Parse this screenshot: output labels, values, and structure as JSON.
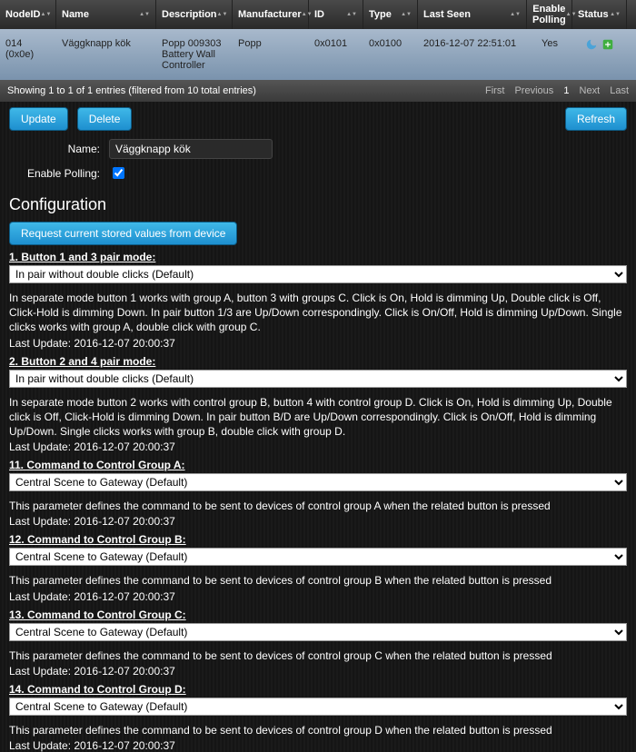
{
  "table": {
    "headers": {
      "node": "NodeID",
      "name": "Name",
      "desc": "Description",
      "manu": "Manufacturer",
      "id": "ID",
      "type": "Type",
      "last": "Last Seen",
      "poll": "Enable Polling",
      "status": "Status"
    },
    "row": {
      "node": "014 (0x0e)",
      "name": "Väggknapp kök",
      "desc": "Popp 009303 Battery Wall Controller",
      "manu": "Popp",
      "id": "0x0101",
      "type": "0x0100",
      "last": "2016-12-07 22:51:01",
      "poll": "Yes"
    },
    "footer": "Showing 1 to 1 of 1 entries (filtered from 10 total entries)",
    "pager": {
      "first": "First",
      "prev": "Previous",
      "page": "1",
      "next": "Next",
      "last": "Last"
    }
  },
  "buttons": {
    "update": "Update",
    "delete": "Delete",
    "refresh": "Refresh",
    "request": "Request current stored values from device"
  },
  "form": {
    "name_label": "Name:",
    "name_value": "Väggknapp kök",
    "poll_label": "Enable Polling:",
    "poll_checked": true
  },
  "section": "Configuration",
  "params": [
    {
      "label": "1. Button 1 and 3 pair mode:",
      "value": "In pair without double clicks (Default)",
      "desc": "In separate mode button 1 works with group A, button 3 with groups C. Click is On, Hold is dimming Up, Double click is Off, Click-Hold is dimming Down. In pair button 1/3 are Up/Down correspondingly. Click is On/Off, Hold is dimming Up/Down. Single clicks works with group A, double click with group C.",
      "update": "Last Update: 2016-12-07 20:00:37"
    },
    {
      "label": "2. Button 2 and 4 pair mode:",
      "value": "In pair without double clicks (Default)",
      "desc": "In separate mode button 2 works with control group B, button 4 with control group D. Click is On, Hold is dimming Up, Double click is Off, Click-Hold is dimming Down. In pair button B/D are Up/Down correspondingly. Click is On/Off, Hold is dimming Up/Down. Single clicks works with group B, double click with group D.",
      "update": "Last Update: 2016-12-07 20:00:37"
    },
    {
      "label": "11. Command to Control Group A:",
      "value": "Central Scene to Gateway (Default)",
      "desc": "This parameter defines the command to be sent to devices of control group A when the related button is pressed",
      "update": "Last Update: 2016-12-07 20:00:37"
    },
    {
      "label": "12. Command to Control Group B:",
      "value": "Central Scene to Gateway (Default)",
      "desc": "This parameter defines the command to be sent to devices of control group B when the related button is pressed",
      "update": "Last Update: 2016-12-07 20:00:37"
    },
    {
      "label": "13. Command to Control Group C:",
      "value": "Central Scene to Gateway (Default)",
      "desc": "This parameter defines the command to be sent to devices of control group C when the related button is pressed",
      "update": "Last Update: 2016-12-07 20:00:37"
    },
    {
      "label": "14. Command to Control Group D:",
      "value": "Central Scene to Gateway (Default)",
      "desc": "This parameter defines the command to be sent to devices of control group D when the related button is pressed",
      "update": "Last Update: 2016-12-07 20:00:37"
    }
  ]
}
